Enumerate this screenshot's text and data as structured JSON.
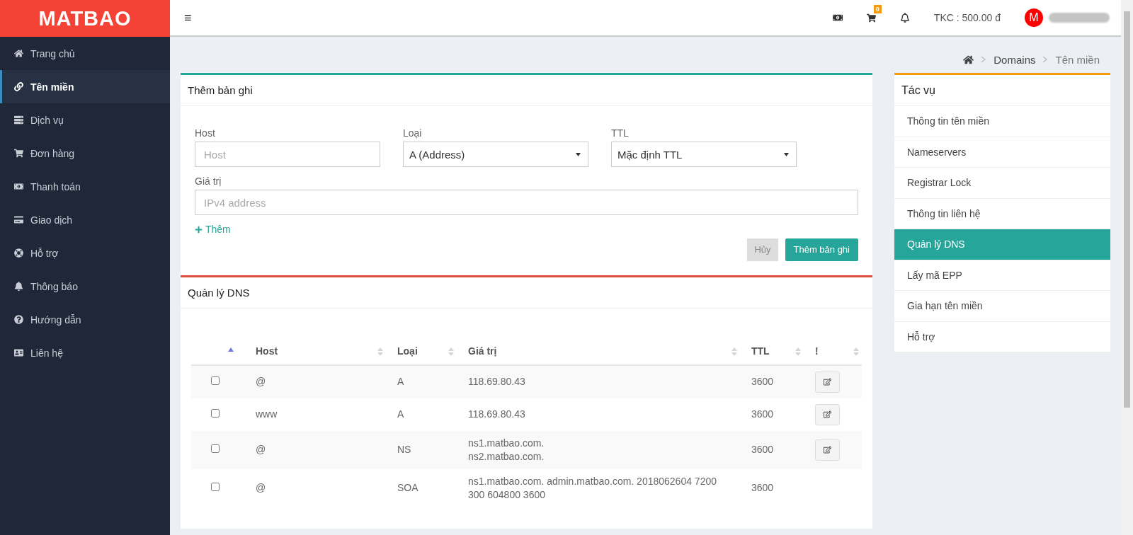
{
  "logo": "MATBAO",
  "header": {
    "menu_glyph": "≡",
    "cart_count": "0",
    "balance": "TKC : 500.00 đ",
    "avatar_letter": "M"
  },
  "sidebar": {
    "items": [
      {
        "label": "Trang chủ",
        "selected": false
      },
      {
        "label": "Tên miền",
        "selected": true
      },
      {
        "label": "Dịch vụ",
        "selected": false
      },
      {
        "label": "Đơn hàng",
        "selected": false
      },
      {
        "label": "Thanh toán",
        "selected": false
      },
      {
        "label": "Giao dịch",
        "selected": false
      },
      {
        "label": "Hỗ trợ",
        "selected": false
      },
      {
        "label": "Thông báo",
        "selected": false
      },
      {
        "label": "Hướng dẫn",
        "selected": false
      },
      {
        "label": "Liên hệ",
        "selected": false
      }
    ]
  },
  "breadcrumb": [
    "Domains",
    "Tên miền"
  ],
  "add_record": {
    "title": "Thêm bản ghi",
    "fields": [
      {
        "label": "Host",
        "kind": "input",
        "placeholder": "Host"
      },
      {
        "label": "Loại",
        "kind": "select",
        "value": "A (Address)"
      },
      {
        "label": "TTL",
        "kind": "select",
        "value": "Mặc định TTL"
      }
    ],
    "value_field": {
      "label": "Giá trị",
      "placeholder": "IPv4 address"
    },
    "add_link": "Thêm",
    "cancel_button": {
      "label": "Hủy",
      "disabled": true
    },
    "submit_button": "Thêm bản ghi"
  },
  "dns": {
    "title": "Quản lý DNS",
    "columns": [
      {
        "sorted": true
      },
      {
        "label": "Host",
        "sorted": false
      },
      {
        "label": "Loại",
        "sorted": false
      },
      {
        "label": "Giá trị",
        "sorted": false
      },
      {
        "label": "TTL",
        "sorted": false
      },
      {
        "label": "!",
        "sorted": false
      }
    ],
    "rows": [
      {
        "checked": false,
        "host": "@",
        "type": "A",
        "values": [
          "118.69.80.43"
        ],
        "ttl": "3600",
        "editable": true
      },
      {
        "checked": false,
        "host": "www",
        "type": "A",
        "values": [
          "118.69.80.43"
        ],
        "ttl": "3600",
        "editable": true
      },
      {
        "checked": false,
        "host": "@",
        "type": "NS",
        "values": [
          "ns1.matbao.com.",
          "ns2.matbao.com."
        ],
        "ttl": "3600",
        "editable": true
      },
      {
        "checked": false,
        "host": "@",
        "type": "SOA",
        "values": [
          "ns1.matbao.com. admin.matbao.com. 2018062604 7200 300 604800 3600"
        ],
        "ttl": "3600",
        "editable": false
      }
    ]
  },
  "tasks": {
    "title": "Tác vụ",
    "items": [
      {
        "label": "Thông tin tên miền",
        "selected": false
      },
      {
        "label": "Nameservers",
        "selected": false
      },
      {
        "label": "Registrar Lock",
        "selected": false
      },
      {
        "label": "Thông tin liên hệ",
        "selected": false
      },
      {
        "label": "Quản lý DNS",
        "selected": true
      },
      {
        "label": "Lấy mã EPP",
        "selected": false
      },
      {
        "label": "Gia hạn tên miền",
        "selected": false
      },
      {
        "label": "Hỗ trợ",
        "selected": false
      }
    ]
  }
}
